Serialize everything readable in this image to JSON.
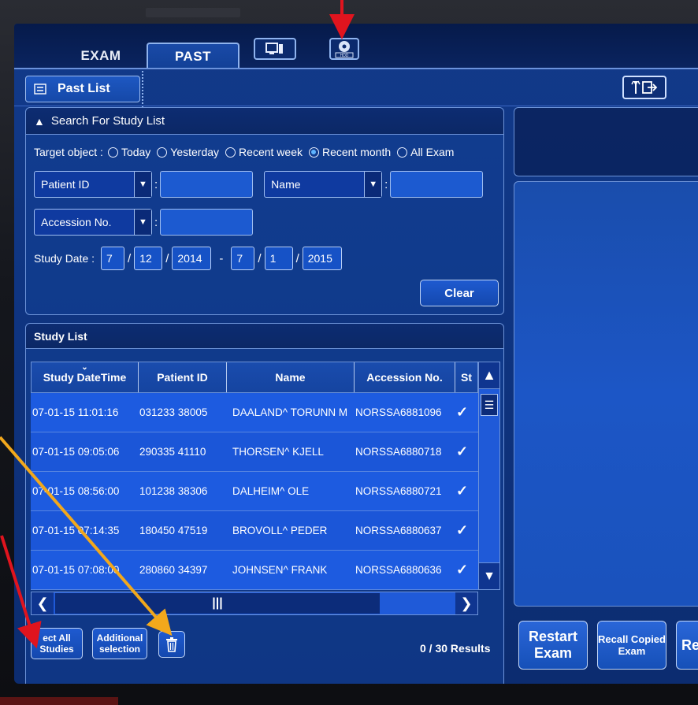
{
  "tabs": {
    "exam": "EXAM",
    "past": "PAST",
    "hdd_label": "HDD"
  },
  "subheader": {
    "past_list": "Past List"
  },
  "search": {
    "title": "Search For Study List",
    "target_label": "Target object :",
    "options": [
      {
        "label": "Today",
        "selected": false
      },
      {
        "label": "Yesterday",
        "selected": false
      },
      {
        "label": "Recent week",
        "selected": false
      },
      {
        "label": "Recent month",
        "selected": true
      },
      {
        "label": "All Exam",
        "selected": false
      }
    ],
    "field1_select": "Patient ID",
    "field2_select": "Name",
    "field3_select": "Accession No.",
    "study_date_label": "Study Date :",
    "date_from": {
      "month": "7",
      "day": "12",
      "year": "2014"
    },
    "date_to": {
      "month": "7",
      "day": "1",
      "year": "2015"
    },
    "date_separator": "-",
    "clear_label": "Clear"
  },
  "study_list": {
    "title": "Study List",
    "columns": [
      "Study DateTime",
      "Patient ID",
      "Name",
      "Accession No.",
      "St"
    ],
    "rows": [
      {
        "datetime": "07-01-15 11:01:16",
        "patient_id": "031233 38005",
        "name": "DAALAND^ TORUNN M",
        "accession": "NORSSA6881096"
      },
      {
        "datetime": "07-01-15 09:05:06",
        "patient_id": "290335 41110",
        "name": "THORSEN^ KJELL",
        "accession": "NORSSA6880718"
      },
      {
        "datetime": "07-01-15 08:56:00",
        "patient_id": "101238 38306",
        "name": "DALHEIM^ OLE",
        "accession": "NORSSA6880721"
      },
      {
        "datetime": "07-01-15 07:14:35",
        "patient_id": "180450 47519",
        "name": "BROVOLL^ PEDER",
        "accession": "NORSSA6880637"
      },
      {
        "datetime": "07-01-15 07:08:00",
        "patient_id": "280860 34397",
        "name": "JOHNSEN^ FRANK",
        "accession": "NORSSA6880636"
      }
    ],
    "select_all": "ect All Studies",
    "additional": "Additional selection",
    "results": "0 / 30 Results"
  },
  "right": {
    "restart_exam": "Restart Exam",
    "recall_copied_exam": "Recall Copied Exam",
    "truncated_btn": "Re"
  },
  "colors": {
    "accent": "#1d5be0",
    "arrow_red": "#e0141e",
    "arrow_orange": "#f2a81c"
  }
}
